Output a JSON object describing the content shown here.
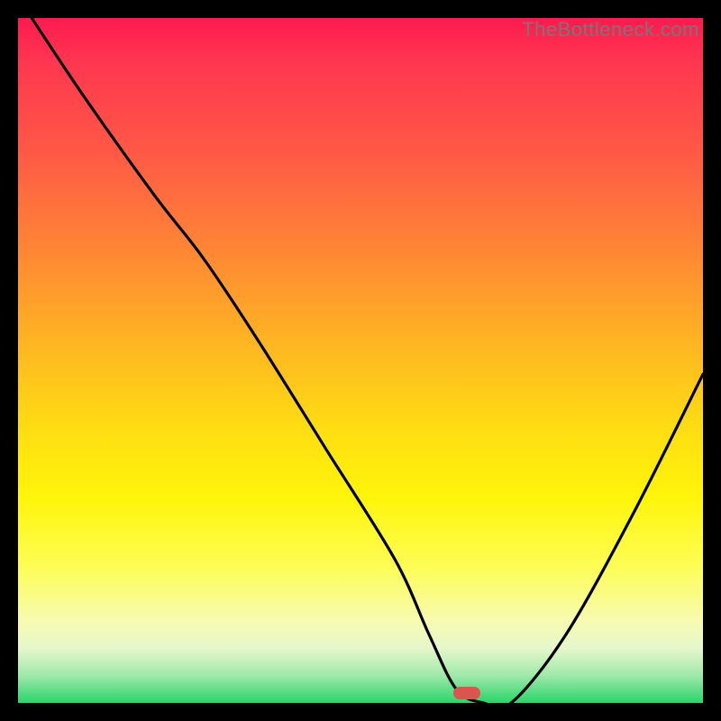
{
  "watermark": "TheBottleneck.com",
  "marker": {
    "x_frac": 0.655,
    "y_frac": 0.985
  },
  "chart_data": {
    "type": "line",
    "title": "",
    "xlabel": "",
    "ylabel": "",
    "xlim": [
      0,
      100
    ],
    "ylim": [
      0,
      100
    ],
    "background": "red-yellow-green vertical gradient",
    "series": [
      {
        "name": "bottleneck-curve",
        "x": [
          2,
          10,
          20,
          27,
          35,
          45,
          55,
          60,
          64,
          68,
          72,
          80,
          90,
          100
        ],
        "y": [
          100,
          88,
          74,
          65,
          53,
          37,
          21,
          10,
          2,
          0,
          0,
          10,
          28,
          48
        ]
      }
    ],
    "marker_point": {
      "x": 66,
      "y": 0
    },
    "note": "Values estimated from pixel positions; axes unlabeled in source image."
  }
}
